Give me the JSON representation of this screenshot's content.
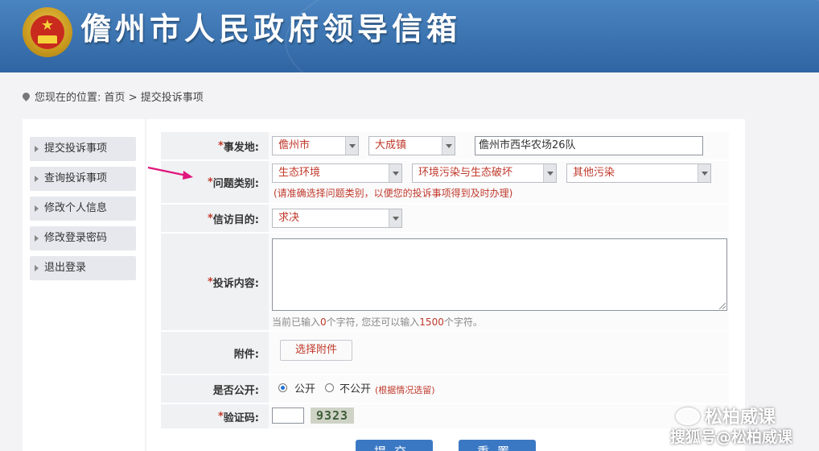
{
  "header": {
    "title": "儋州市人民政府领导信箱"
  },
  "breadcrumb": {
    "prefix": "您现在的位置:",
    "home": "首页",
    "sep": ">",
    "current": "提交投诉事项"
  },
  "sidebar": {
    "items": [
      {
        "label": "提交投诉事项"
      },
      {
        "label": "查询投诉事项"
      },
      {
        "label": "修改个人信息"
      },
      {
        "label": "修改登录密码"
      },
      {
        "label": "退出登录"
      }
    ]
  },
  "form": {
    "required_mark": "*",
    "location": {
      "label": "事发地:",
      "city": "儋州市",
      "town": "大成镇",
      "address": "儋州市西华农场26队"
    },
    "category": {
      "label": "问题类别:",
      "level1": "生态环境",
      "level2": "环境污染与生态破坏",
      "level3": "其他污染",
      "hint": "(请准确选择问题类别，以便您的投诉事项得到及时办理)"
    },
    "purpose": {
      "label": "信访目的:",
      "value": "求决"
    },
    "content": {
      "label": "投诉内容:",
      "counter_prefix": "当前已输入",
      "entered": "0",
      "counter_mid": "个字符, 您还可以输入",
      "remaining": "1500",
      "counter_suffix": "个字符。"
    },
    "attachment": {
      "label": "附件:",
      "button": "选择附件"
    },
    "public": {
      "label": "是否公开:",
      "yes": "公开",
      "no": "不公开",
      "note": "(根据情况选留)",
      "selected": "yes"
    },
    "captcha": {
      "label": "验证码:",
      "code": "9323"
    }
  },
  "actions": {
    "submit": "提交",
    "reset": "重置"
  },
  "watermark": {
    "line1": "松柏威课",
    "line2": "搜狐号@松柏威课"
  },
  "colors": {
    "header_bg": "#3a6fa8",
    "required": "#c0392b",
    "button": "#3b78c4",
    "arrow": "#e0167d"
  }
}
